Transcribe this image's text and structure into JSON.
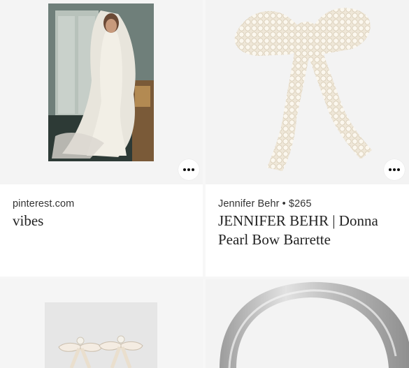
{
  "cards": [
    {
      "source": "pinterest.com",
      "title": "vibes",
      "image": "bride-lace-veil-photo",
      "more_icon": "more-dots-icon"
    },
    {
      "source": "Jennifer Behr • $265",
      "title_line1": "JENNIFER BEHR | Donna",
      "title_line2": "Pearl Bow Barrette",
      "image": "pearl-bow-barrette-photo",
      "more_icon": "more-dots-icon"
    },
    {
      "image": "pearl-bow-earrings-photo"
    },
    {
      "image": "satin-headband-photo"
    }
  ],
  "colors": {
    "image_bg": "#f3f3f3",
    "text": "#222222",
    "accent": "#111111"
  }
}
